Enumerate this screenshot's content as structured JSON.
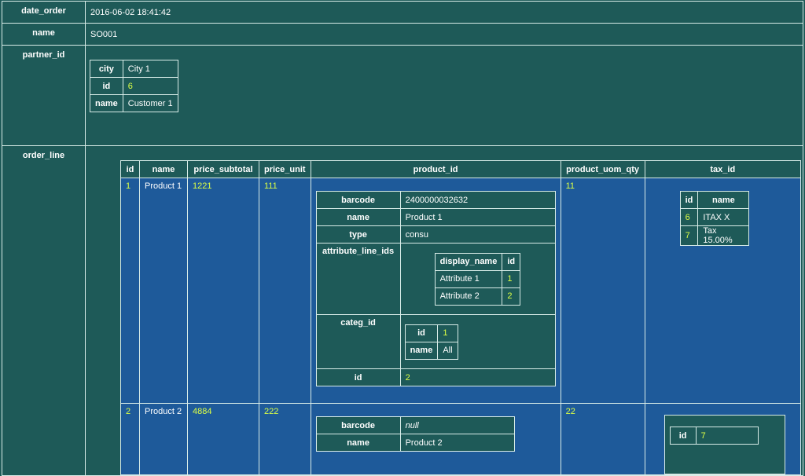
{
  "record": {
    "date_order": {
      "label": "date_order",
      "value": "2016-06-02 18:41:42"
    },
    "name": {
      "label": "name",
      "value": "SO001"
    },
    "partner_id": {
      "label": "partner_id",
      "city": {
        "label": "city",
        "value": "City 1"
      },
      "id": {
        "label": "id",
        "value": "6"
      },
      "name": {
        "label": "name",
        "value": "Customer 1"
      }
    },
    "order_line": {
      "label": "order_line"
    }
  },
  "lines": {
    "headers": [
      "id",
      "name",
      "price_subtotal",
      "price_unit",
      "product_id",
      "product_uom_qty",
      "tax_id"
    ],
    "rows": [
      {
        "id": "1",
        "name": "Product 1",
        "price_subtotal": "1221",
        "price_unit": "111",
        "product_uom_qty": "11",
        "product": {
          "barcode": {
            "label": "barcode",
            "value": "2400000032632"
          },
          "name": {
            "label": "name",
            "value": "Product 1"
          },
          "type": {
            "label": "type",
            "value": "consu"
          },
          "attribute_line_ids": {
            "label": "attribute_line_ids",
            "headers": [
              "display_name",
              "id"
            ],
            "rows": [
              [
                "Attribute 1",
                "1"
              ],
              [
                "Attribute 2",
                "2"
              ]
            ]
          },
          "categ_id": {
            "label": "categ_id",
            "id_label": "id",
            "id": "1",
            "name_label": "name",
            "name": "All"
          },
          "id": {
            "label": "id",
            "value": "2"
          }
        },
        "tax": {
          "headers": [
            "id",
            "name"
          ],
          "rows": [
            [
              "6",
              "ITAX X"
            ],
            [
              "7",
              "Tax 15.00%"
            ]
          ]
        }
      },
      {
        "id": "2",
        "name": "Product 2",
        "price_subtotal": "4884",
        "price_unit": "222",
        "product_uom_qty": "22",
        "product": {
          "barcode": {
            "label": "barcode",
            "value": "null"
          },
          "name": {
            "label": "name",
            "value": "Product 2"
          }
        },
        "tax": {
          "id_label": "id",
          "id": "7"
        }
      }
    ]
  }
}
